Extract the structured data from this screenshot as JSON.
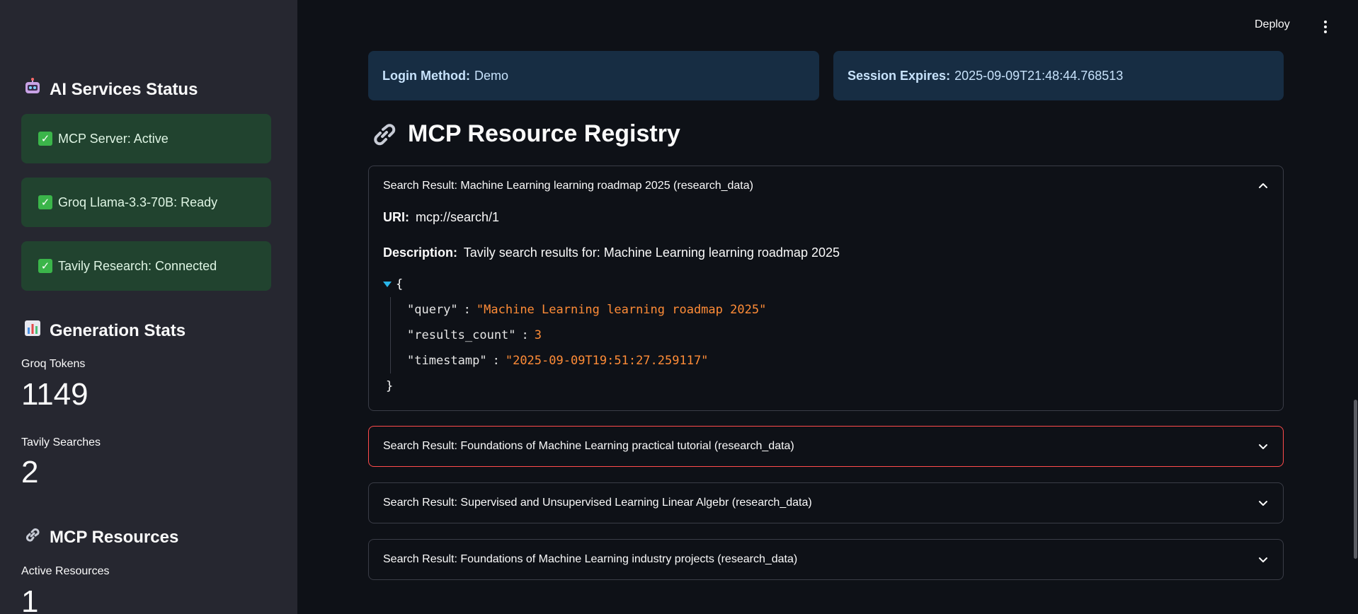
{
  "header": {
    "deploy_label": "Deploy"
  },
  "sidebar": {
    "services_heading": "AI Services Status",
    "services": [
      {
        "label": "MCP Server: Active"
      },
      {
        "label": "Groq Llama-3.3-70B: Ready"
      },
      {
        "label": "Tavily Research: Connected"
      }
    ],
    "stats_heading": "Generation Stats",
    "groq_tokens_label": "Groq Tokens",
    "groq_tokens_value": "1149",
    "tavily_searches_label": "Tavily Searches",
    "tavily_searches_value": "2",
    "resources_heading": "MCP Resources",
    "active_resources_label": "Active Resources",
    "active_resources_value": "1"
  },
  "info": {
    "login_label": "Login Method:",
    "login_value": "Demo",
    "session_label": "Session Expires:",
    "session_value": "2025-09-09T21:48:44.768513"
  },
  "registry": {
    "title": "MCP Resource Registry",
    "expanded": {
      "title": "Search Result: Machine Learning learning roadmap 2025 (research_data)",
      "uri_label": "URI:",
      "uri_value": "mcp://search/1",
      "desc_label": "Description:",
      "desc_value": "Tavily search results for: Machine Learning learning roadmap 2025",
      "json": {
        "open_brace": "{",
        "close_brace": "}",
        "rows": [
          {
            "key": "\"query\"",
            "value": "\"Machine Learning learning roadmap 2025\""
          },
          {
            "key": "\"results_count\"",
            "value": "3"
          },
          {
            "key": "\"timestamp\"",
            "value": "\"2025-09-09T19:51:27.259117\""
          }
        ]
      }
    },
    "collapsed": [
      {
        "title": "Search Result: Foundations of Machine Learning practical tutorial (research_data)"
      },
      {
        "title": "Search Result: Supervised and Unsupervised Learning Linear Algebr (research_data)"
      },
      {
        "title": "Search Result: Foundations of Machine Learning industry projects (research_data)"
      }
    ]
  },
  "colors": {
    "background": "#0e1117",
    "sidebar": "#262730",
    "success_bg": "#21432f",
    "info_bg": "#172d43",
    "focus_border": "#ff4b4b",
    "json_value": "#ff8c37"
  }
}
